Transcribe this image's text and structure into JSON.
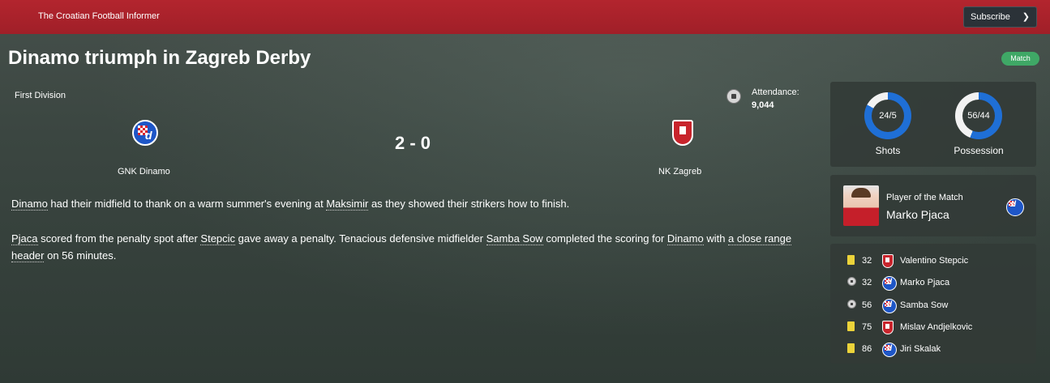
{
  "header": {
    "brand": "The Croatian Football Informer",
    "subscribe_label": "Subscribe",
    "subscribe_icon": "chevron-down-icon"
  },
  "article": {
    "headline": "Dinamo triumph in Zagreb Derby",
    "badge": "Match"
  },
  "match": {
    "competition": "First Division",
    "attendance_label": "Attendance:",
    "attendance_value": "9,044",
    "home_team": "GNK Dinamo",
    "away_team": "NK Zagreb",
    "score": "2 - 0"
  },
  "body": {
    "p1": [
      {
        "text": "Dinamo",
        "link": true
      },
      {
        "text": " had their midfield to thank on a warm summer's evening at ",
        "link": false
      },
      {
        "text": "Maksimir",
        "link": true
      },
      {
        "text": " as they showed their strikers how to finish.",
        "link": false
      }
    ],
    "p2": [
      {
        "text": "Pjaca",
        "link": true
      },
      {
        "text": " scored from the penalty spot after ",
        "link": false
      },
      {
        "text": "Stepcic",
        "link": true
      },
      {
        "text": " gave away a penalty. Tenacious defensive midfielder ",
        "link": false
      },
      {
        "text": "Samba Sow",
        "link": true
      },
      {
        "text": " completed the scoring for ",
        "link": false
      },
      {
        "text": "Dinamo",
        "link": true
      },
      {
        "text": " with ",
        "link": false
      },
      {
        "text": "a close range header",
        "link": true
      },
      {
        "text": " on 56 minutes.",
        "link": false
      }
    ]
  },
  "stats": {
    "shots": {
      "label": "Shots",
      "text": "24/5",
      "home": 24,
      "away": 5
    },
    "possession": {
      "label": "Possession",
      "text": "56/44",
      "home": 56,
      "away": 44
    },
    "colors": {
      "home": "#1f6fd6",
      "away": "#f2f2f2"
    }
  },
  "player_of_match": {
    "label": "Player of the Match",
    "name": "Marko Pjaca",
    "team": "dinamo"
  },
  "events": [
    {
      "icon": "yellow-card-icon",
      "minute": "32",
      "team": "zagreb",
      "player": "Valentino Stepcic"
    },
    {
      "icon": "goal-ball-icon",
      "minute": "32",
      "team": "dinamo",
      "player": "Marko Pjaca"
    },
    {
      "icon": "goal-ball-icon",
      "minute": "56",
      "team": "dinamo",
      "player": "Samba Sow"
    },
    {
      "icon": "yellow-card-icon",
      "minute": "75",
      "team": "zagreb",
      "player": "Mislav Andjelkovic"
    },
    {
      "icon": "yellow-card-icon",
      "minute": "86",
      "team": "dinamo",
      "player": "Jiri Skalak"
    }
  ]
}
